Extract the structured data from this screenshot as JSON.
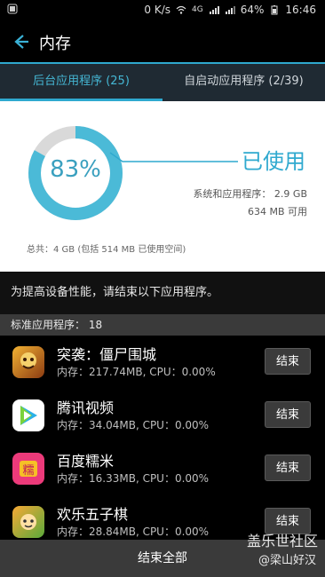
{
  "status": {
    "speed": "0 K/s",
    "network": "4G",
    "battery": "64%",
    "time": "16:46"
  },
  "header": {
    "title": "内存"
  },
  "tabs": [
    {
      "label": "后台应用程序 (25)"
    },
    {
      "label": "自启动应用程序 (2/39)"
    }
  ],
  "usage": {
    "percent": "83%",
    "used_label": "已使用",
    "system_apps": "系统和应用程序： 2.9 GB",
    "available": "634 MB 可用",
    "total": "总共：4 GB (包括 514 MB 已使用空间)",
    "ratio": 0.83
  },
  "hint": "为提高设备性能，请结束以下应用程序。",
  "section_title": "标准应用程序： 18",
  "apps": [
    {
      "name": "突袭：僵尸围城",
      "mem": "内存：217.74MB, CPU：0.00%",
      "end": "结束"
    },
    {
      "name": "腾讯视频",
      "mem": "内存：34.04MB, CPU：0.00%",
      "end": "结束"
    },
    {
      "name": "百度糯米",
      "mem": "内存：16.33MB, CPU：0.00%",
      "end": "结束"
    },
    {
      "name": "欢乐五子棋",
      "mem": "内存：28.84MB, CPU：0.00%",
      "end": "结束"
    }
  ],
  "end_all": "结束全部",
  "watermark": {
    "line1": "盖乐世社区",
    "line2": "@梁山好汉"
  }
}
